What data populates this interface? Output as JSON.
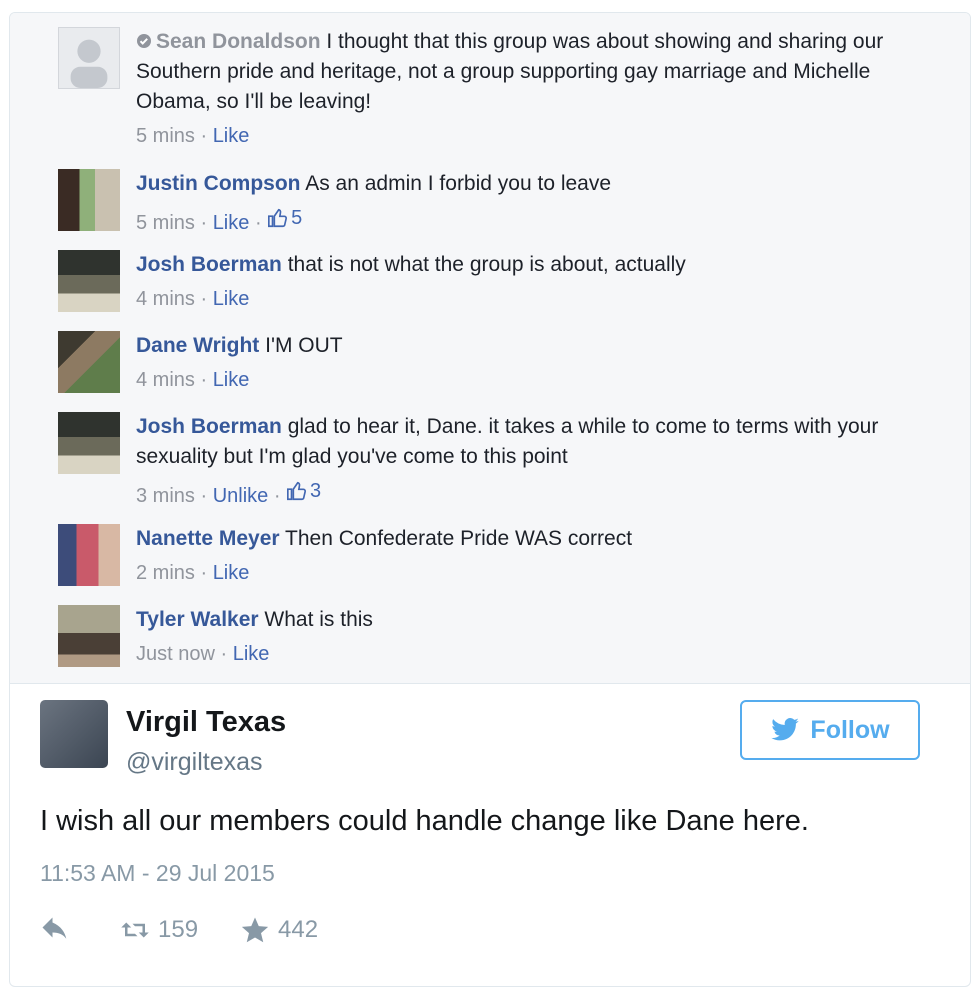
{
  "comments": [
    {
      "name": "Sean Donaldson",
      "text": " I thought that this group was about showing and sharing our Southern pride and heritage, not a group supporting gay marriage and Michelle Obama, so I'll be leaving!",
      "time": "5 mins",
      "sep": " · ",
      "action": "Like"
    },
    {
      "name": "Justin Compson",
      "text": " As an admin I forbid you to leave",
      "time": "5 mins",
      "sep": " · ",
      "action": "Like",
      "likes": "5"
    },
    {
      "name": "Josh Boerman",
      "text": " that is not what the group is about, actually",
      "time": "4 mins",
      "sep": " · ",
      "action": "Like"
    },
    {
      "name": "Dane Wright",
      "text": " I'M OUT",
      "time": "4 mins",
      "sep": " · ",
      "action": "Like"
    },
    {
      "name": "Josh Boerman",
      "text": " glad to hear it, Dane. it takes a while to come to terms with your sexuality but I'm glad you've come to this point",
      "time": "3 mins",
      "sep": " · ",
      "action": "Unlike",
      "likes": "3"
    },
    {
      "name": "Nanette Meyer",
      "text": " Then Confederate Pride WAS correct",
      "time": "2 mins",
      "sep": " · ",
      "action": "Like"
    },
    {
      "name": "Tyler Walker",
      "text": " What is this",
      "time": "Just now",
      "sep": " · ",
      "action": "Like"
    }
  ],
  "tweet": {
    "name": "Virgil Texas",
    "handle": "@virgiltexas",
    "follow_label": "Follow",
    "text": "I wish all our members could handle change like Dane here.",
    "timestamp": "11:53 AM - 29 Jul 2015",
    "retweets": "159",
    "favorites": "442"
  },
  "colors": {
    "twitter_blue": "#55acee",
    "fb_link": "#365899"
  },
  "icons": {
    "reply": "reply-icon",
    "retweet": "retweet-icon",
    "favorite": "star-icon",
    "like": "thumbs-up-icon",
    "bird": "twitter-bird-icon",
    "verified": "verified-icon"
  }
}
